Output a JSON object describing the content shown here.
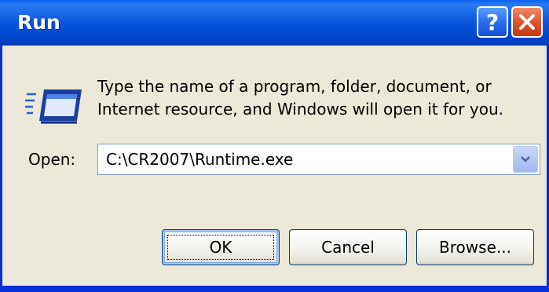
{
  "window": {
    "title": "Run",
    "help_label": "?",
    "close_label": "✕"
  },
  "body": {
    "description_line1": "Type the name of a program, folder, document, or",
    "description_line2": "Internet resource, and Windows will open it for you.",
    "icon": "run-icon"
  },
  "open_field": {
    "label": "Open:",
    "value": "C:\\CR2007\\Runtime.exe",
    "dropdown_icon": "chevron-down-icon"
  },
  "buttons": {
    "ok": "OK",
    "cancel": "Cancel",
    "browse": "Browse..."
  },
  "colors": {
    "titlebar": "#0050d8",
    "client_bg": "#ece9d8",
    "close": "#e0542b",
    "border": "#0831d9"
  }
}
